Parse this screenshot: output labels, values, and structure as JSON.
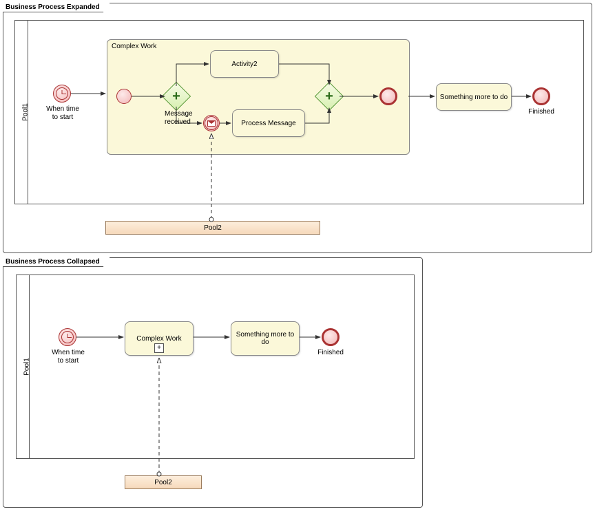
{
  "frames": {
    "expanded": {
      "title": "Business Process Expanded"
    },
    "collapsed": {
      "title": "Business Process Collapsed"
    }
  },
  "pools": {
    "pool1": "Pool1",
    "pool2": "Pool2"
  },
  "expanded": {
    "timer_label": "When time to start",
    "subprocess_title": "Complex Work",
    "activity2": "Activity2",
    "msg_received": "Message received",
    "process_message": "Process Message",
    "something_more": "Something more to do",
    "finished": "Finished"
  },
  "collapsed": {
    "timer_label": "When time to start",
    "complex_work": "Complex Work",
    "something_more": "Something more to do",
    "finished": "Finished"
  }
}
